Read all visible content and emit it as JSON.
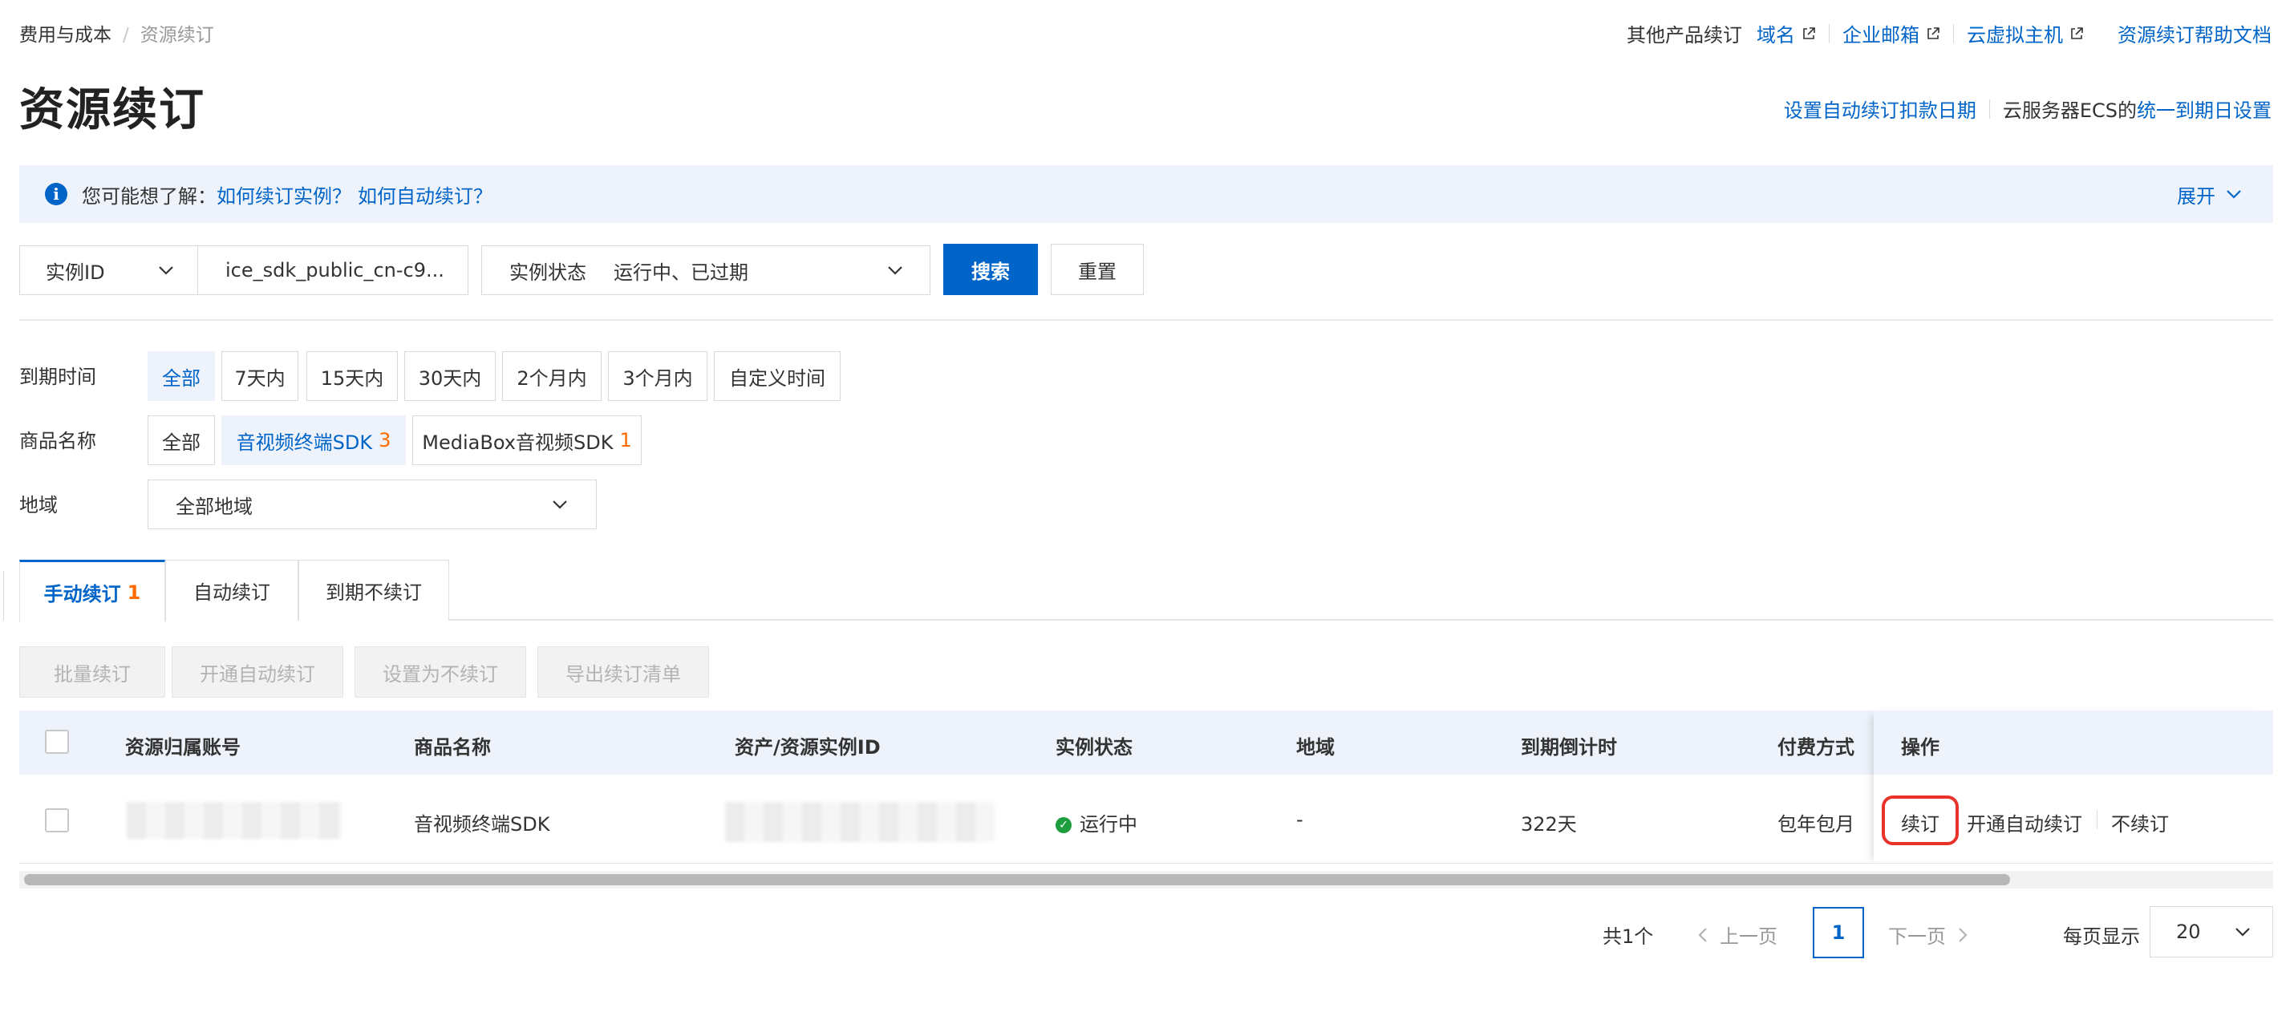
{
  "breadcrumb": {
    "parent": "费用与成本",
    "separator": "/",
    "current": "资源续订"
  },
  "top_links": {
    "label": "其他产品续订",
    "domain": "域名",
    "mail": "企业邮箱",
    "vhost": "云虚拟主机",
    "help": "资源续订帮助文档"
  },
  "page_title": "资源续订",
  "settings": {
    "auto_deduct": "设置自动续订扣款日期",
    "ecs_prefix": "云服务器ECS的",
    "unified_date": "统一到期日设置"
  },
  "banner": {
    "icon": "i",
    "prefix": "您可能想了解：",
    "link1": "如何续订实例？",
    "link2": "如何自动续订？",
    "expand": "展开"
  },
  "search": {
    "field_select": "实例ID",
    "field_value": "ice_sdk_public_cn-c9...",
    "status_label": "实例状态",
    "status_value": "运行中、已过期",
    "search_btn": "搜索",
    "reset_btn": "重置"
  },
  "filters": {
    "expire_label": "到期时间",
    "expire_options": [
      "全部",
      "7天内",
      "15天内",
      "30天内",
      "2个月内",
      "3个月内",
      "自定义时间"
    ],
    "product_label": "商品名称",
    "product_all": "全部",
    "product_1": "音视频终端SDK",
    "product_1_count": "3",
    "product_2": "MediaBox音视频SDK",
    "product_2_count": "1",
    "region_label": "地域",
    "region_value": "全部地域"
  },
  "tabs": [
    {
      "label": "手动续订",
      "count": "1"
    },
    {
      "label": "自动续订",
      "count": ""
    },
    {
      "label": "到期不续订",
      "count": ""
    }
  ],
  "batch": {
    "batch_renew": "批量续订",
    "enable_auto": "开通自动续订",
    "set_no_renew": "设置为不续订",
    "export": "导出续订清单"
  },
  "table": {
    "headers": [
      "资源归属账号",
      "商品名称",
      "资产/资源实例ID",
      "实例状态",
      "地域",
      "到期倒计时",
      "付费方式",
      "操作"
    ],
    "row": {
      "product": "音视频终端SDK",
      "status": "运行中",
      "region": "-",
      "countdown": "322天",
      "payment": "包年包月",
      "op_renew": "续订",
      "op_auto": "开通自动续订",
      "op_no_renew": "不续订"
    }
  },
  "pagination": {
    "total": "共1个",
    "prev": "上一页",
    "page": "1",
    "next": "下一页",
    "page_size_label": "每页显示",
    "page_size": "20"
  },
  "colors": {
    "primary": "#0064c8",
    "accent_count": "#ff6a00",
    "banner_bg": "#eef3fb",
    "success": "#1e9e3e",
    "highlight": "#e8322a"
  }
}
